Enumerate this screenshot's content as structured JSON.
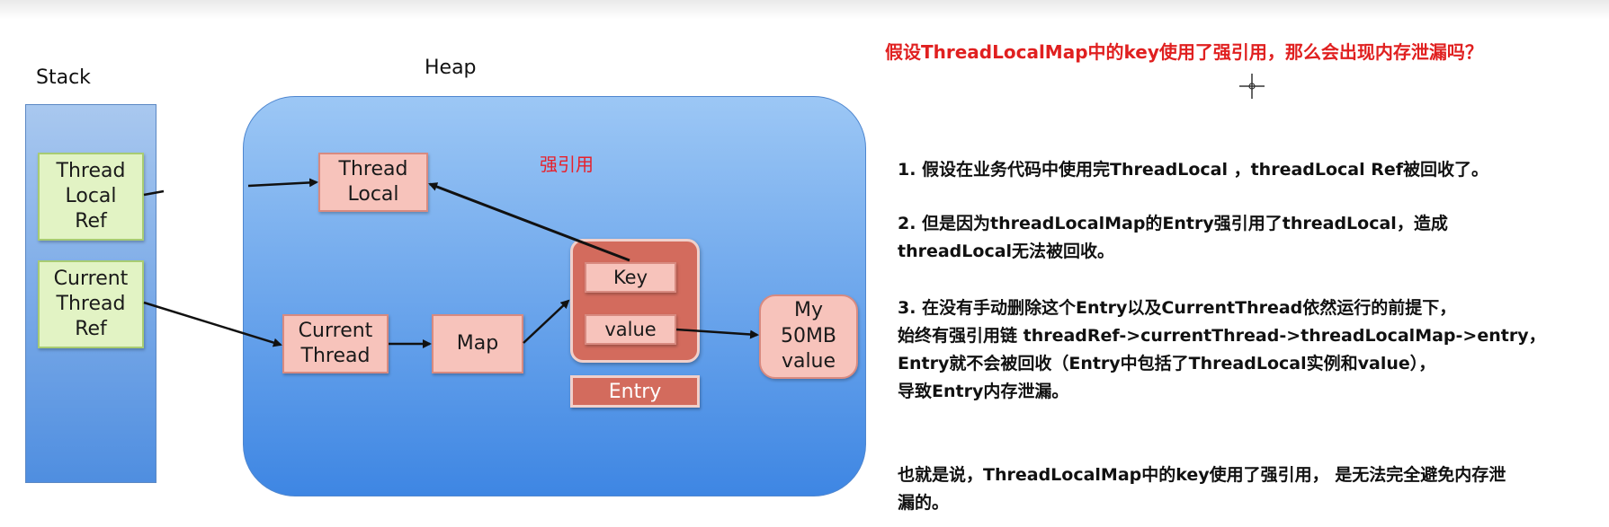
{
  "diagram": {
    "stack_label": "Stack",
    "heap_label": "Heap",
    "strong_ref_label": "强引用",
    "stack_boxes": [
      {
        "label": "Thread\nLocal\nRef"
      },
      {
        "label": "Current\nThread\nRef"
      }
    ],
    "heap_boxes": {
      "thread_local": "Thread\nLocal",
      "current_thread": "Current\nThread",
      "map": "Map",
      "key": "Key",
      "value": "value",
      "entry": "Entry",
      "my_value": "My\n50MB\nvalue"
    },
    "colors": {
      "stack_fill": "#4f8ee0",
      "heap_fill": "#3e86e3",
      "green_box": "#e2f3c4",
      "pink_box": "#f7c3bb",
      "entry_fill": "#d36b5d",
      "red_text": "#e02020"
    }
  },
  "notes": {
    "question": "假设ThreadLocalMap中的key使用了强引用，那么会出现内存泄漏吗？",
    "point1": [
      "1. 假设在业务代码中使用完ThreadLocal ，threadLocal Ref被回收了。"
    ],
    "point2": [
      "2. 但是因为threadLocalMap的Entry强引用了threadLocal，造成",
      "threadLocal无法被回收。"
    ],
    "point3": [
      "3. 在没有手动删除这个Entry以及CurrentThread依然运行的前提下，",
      "始终有强引用链 threadRef->currentThread->threadLocalMap->entry，",
      "Entry就不会被回收（Entry中包括了ThreadLocal实例和value），",
      "导致Entry内存泄漏。"
    ],
    "conclusion": [
      "也就是说，ThreadLocalMap中的key使用了强引用， 是无法完全避免内存泄",
      "漏的。"
    ]
  },
  "icons": {
    "cursor": "crosshair-cursor-icon"
  }
}
